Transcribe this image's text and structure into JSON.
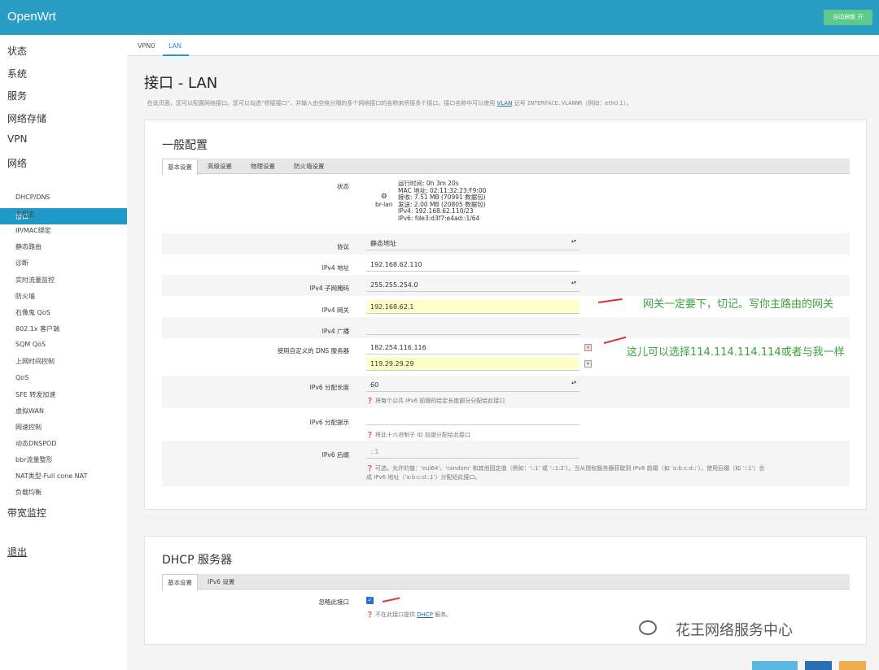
{
  "app": {
    "brand": "OpenWrt",
    "auto_refresh": "自动刷新 开"
  },
  "sidebar": {
    "headers": [
      "状态",
      "系统",
      "服务",
      "网络存储",
      "VPN",
      "网络",
      "带宽监控",
      "退出"
    ],
    "items": [
      "接口",
      "DHCP/DNS",
      "主机名",
      "IP/MAC绑定",
      "静态路由",
      "诊断",
      "实时流量监控",
      "防火墙",
      "石像鬼 QoS",
      "802.1x 客户端",
      "SQM QoS",
      "上网时间控制",
      "QoS",
      "SFE 转发加速",
      "虚拟WAN",
      "网速控制",
      "动态DNSPOD",
      "bbr流量整形",
      "NAT类型-Full cone NAT",
      "负载均衡"
    ],
    "active_item": "接口"
  },
  "iface_tabs": [
    "VPN0",
    "LAN"
  ],
  "page": {
    "title": "接口 - LAN",
    "desc_pre": "在此页面，您可以配置网络接口。您可以勾选“桥接接口”，并输入由空格分隔的多个网络接口的名称来桥接多个接口。接口名称中可以使用 ",
    "desc_link": "VLAN",
    "desc_mid": " 记号 ",
    "desc_code": "INTERFACE.VLANNR",
    "desc_post": "（例如：eth0.1）。"
  },
  "general": {
    "title": "一般配置",
    "tabs": [
      "基本设置",
      "高级设置",
      "物理设置",
      "防火墙设置"
    ],
    "status_label": "状态",
    "status_iface": "br-lan",
    "status_lines": [
      "运行时间: 0h 3m 20s",
      "MAC 地址: 02:11:32:23:F9:00",
      "接收: 7.51 MB (70991 数据包)",
      "发送: 2.00 MB (20805 数据包)",
      "IPv4: 192.168.62.110/23",
      "IPv6: fde3:d3f7:e4ad::1/64"
    ],
    "protocol_label": "协议",
    "protocol_value": "静态地址",
    "ipv4_addr_label": "IPv4 地址",
    "ipv4_addr_value": "192.168.62.110",
    "netmask_label": "IPv4 子网掩码",
    "netmask_value": "255.255.254.0",
    "gateway_label": "IPv4 网关",
    "gateway_value": "192.168.62.1",
    "broadcast_label": "IPv4 广播",
    "broadcast_value": "",
    "dns_label": "使用自定义的 DNS 服务器",
    "dns_values": [
      "182.254.116.116",
      "119.29.29.29"
    ],
    "ipv6_len_label": "IPv6 分配长度",
    "ipv6_len_value": "60",
    "ipv6_len_hint": "❓ 将每个公共 IPv6 前缀的给定长度部分分配给此接口",
    "ipv6_hint_label": "IPv6 分配提示",
    "ipv6_hint_value": "",
    "ipv6_hint_hint": "❓ 将此十六进制子 ID 前缀分配给此接口",
    "ipv6_suffix_label": "IPv6 后缀",
    "ipv6_suffix_value": "::1",
    "ipv6_suffix_hint1": "❓ 可选。允许的值：'eui64'、'random' 和其他固定值（例如：'::1' 或 '::1:2'）。当从授权服务器获取到 IPv6 前缀（如 'a:b:c:d::'），使用后缀（如 '::1'）合",
    "ipv6_suffix_hint2": "成 IPv6 地址（'a:b:c:d::1'）分配给此接口。"
  },
  "annotations": {
    "gateway_note": "网关一定要下，切记。写你主路由的网关",
    "dns_note": "这儿可以选择114.114.114.114或者与我一样"
  },
  "dhcp": {
    "title": "DHCP 服务器",
    "tabs": [
      "基本设置",
      "IPv6 设置"
    ],
    "ignore_label": "忽略此接口",
    "ignore_hint_pre": "❓ 不在此接口提供 ",
    "ignore_hint_link": "DHCP",
    "ignore_hint_post": " 服务。"
  },
  "watermark": "花王网络服务中心",
  "colors": {
    "topbar": "#2a9dc4",
    "active": "#1f9ac8",
    "annotation": "#3aa23a",
    "arrow": "#dd3333"
  }
}
